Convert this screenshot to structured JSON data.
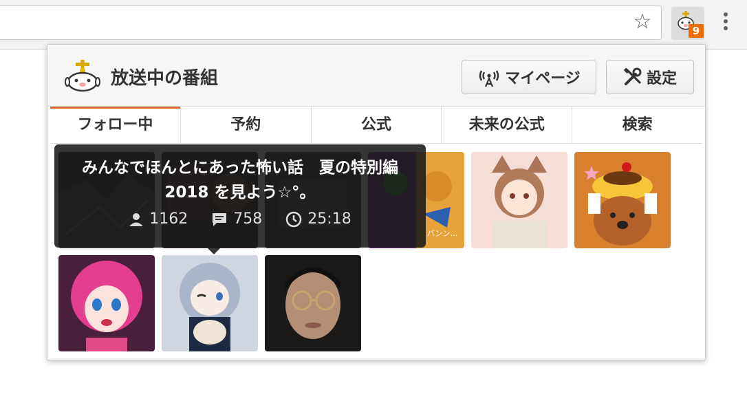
{
  "toolbar": {
    "badge_count": "9"
  },
  "popup": {
    "title": "放送中の番組",
    "mypage_label": "マイページ",
    "settings_label": "設定"
  },
  "tabs": [
    {
      "label": "フォロー中",
      "active": true
    },
    {
      "label": "予約",
      "active": false
    },
    {
      "label": "公式",
      "active": false
    },
    {
      "label": "未来の公式",
      "active": false
    },
    {
      "label": "検索",
      "active": false
    }
  ],
  "tooltip": {
    "title": "みんなでほんとにあった怖い話　夏の特別編2018 を見よう☆°。",
    "viewers": "1162",
    "comments": "758",
    "elapsed": "25:18"
  },
  "thumbnails": {
    "row1": [
      {
        "name": "thumb-dark-illustration"
      },
      {
        "name": "thumb-dark-room"
      },
      {
        "name": "thumb-monochrome"
      },
      {
        "name": "thumb-cartoon-orange"
      },
      {
        "name": "thumb-catgirl"
      },
      {
        "name": "thumb-pudding-dog"
      }
    ],
    "row2": [
      {
        "name": "thumb-pink-hair-girl"
      },
      {
        "name": "thumb-silver-hair-girl"
      },
      {
        "name": "thumb-man-glasses"
      }
    ]
  },
  "colors": {
    "accent": "#e0692c",
    "badge": "#ef6c00"
  }
}
